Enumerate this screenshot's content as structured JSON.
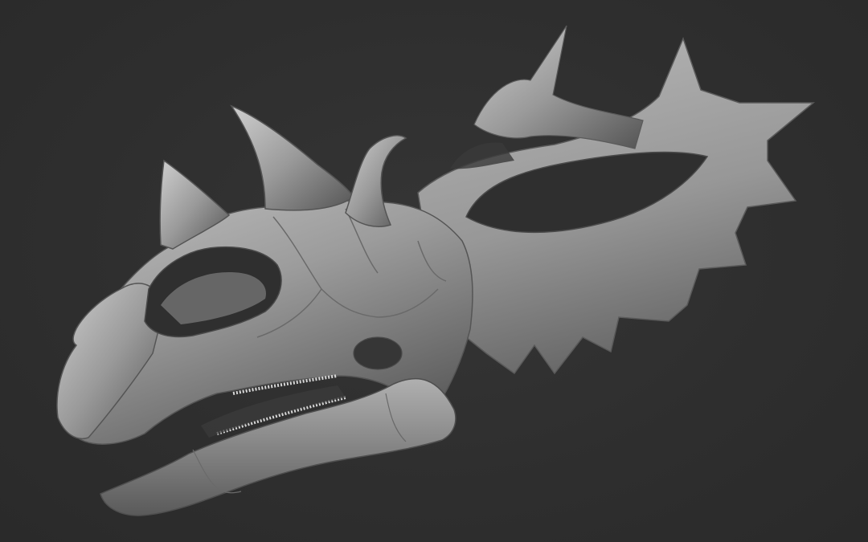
{
  "scene": {
    "background_color": "#2f2f2f",
    "model_base_color": "#8e8e8e",
    "model_highlight_color": "#c9c9c9",
    "model_shadow_color": "#4a4a4a",
    "subject": "ceratopsian-skull-sculpt"
  }
}
